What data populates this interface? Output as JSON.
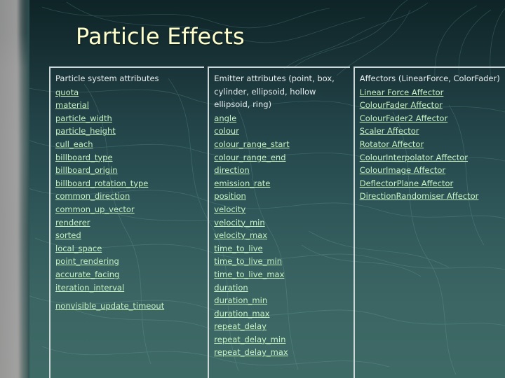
{
  "slide": {
    "title": "Particle Effects",
    "title_color": "#ffffcc",
    "background_color": "#2e4f50",
    "link_color": "#c8f2c2",
    "heading_color": "#e8eeee",
    "border_color": "#cdd8d8"
  },
  "columns": [
    {
      "heading": "Particle system attributes",
      "items": [
        "quota",
        "material",
        "particle_width",
        "particle_height",
        "cull_each",
        "billboard_type",
        "billboard_origin",
        "billboard_rotation_type",
        "common_direction",
        "common_up_vector",
        "renderer",
        "sorted",
        "local_space",
        "point_rendering",
        "accurate_facing",
        "iteration_interval",
        "nonvisible_update_timeout"
      ]
    },
    {
      "heading": "Emitter attributes (point, box, cylinder, ellipsoid, hollow ellipsoid, ring)",
      "items": [
        "angle",
        "colour",
        "colour_range_start",
        "colour_range_end",
        "direction",
        "emission_rate",
        "position",
        "velocity",
        "velocity_min",
        "velocity_max",
        "time_to_live",
        "time_to_live_min",
        "time_to_live_max",
        "duration",
        "duration_min",
        "duration_max",
        "repeat_delay",
        "repeat_delay_min",
        "repeat_delay_max"
      ]
    },
    {
      "heading": "Affectors (LinearForce, ColorFader)",
      "items": [
        "Linear Force Affector",
        "ColourFader Affector",
        "ColourFader2 Affector",
        "Scaler Affector",
        "Rotator Affector",
        "ColourInterpolator Affector",
        "ColourImage Affector",
        "DeflectorPlane Affector",
        "DirectionRandomiser Affector"
      ]
    }
  ]
}
